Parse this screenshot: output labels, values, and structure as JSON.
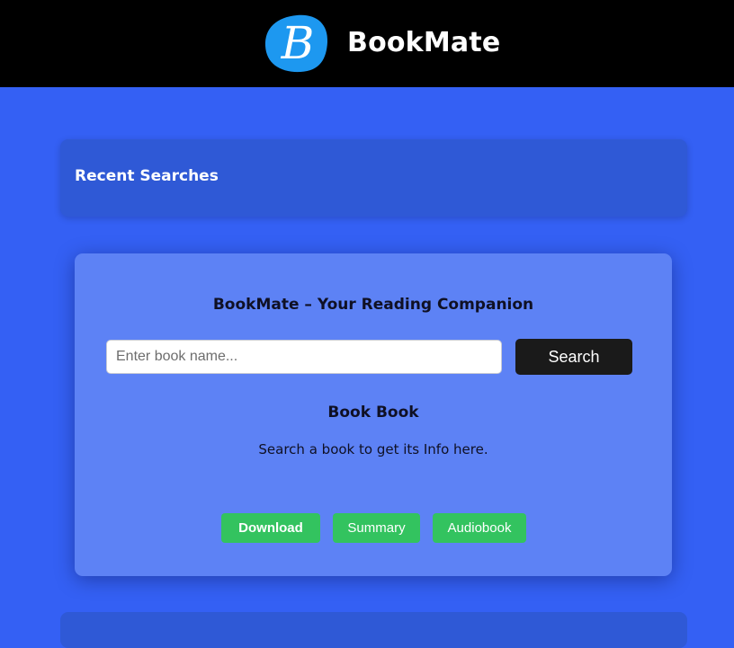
{
  "header": {
    "logo_letter": "B",
    "brand": "BookMate"
  },
  "recent": {
    "title": "Recent Searches"
  },
  "main": {
    "title": "BookMate – Your Reading Companion",
    "search": {
      "placeholder": "Enter book name...",
      "value": "",
      "button_label": "Search"
    },
    "book_title": "Book Book",
    "book_description": "Search a book to get its Info here.",
    "actions": {
      "download_label": "Download",
      "summary_label": "Summary",
      "audiobook_label": "Audiobook"
    }
  },
  "colors": {
    "page_background": "#3460f4",
    "header_background": "#000000",
    "logo_blue": "#1d98f0",
    "panel_background": "#2f59d6",
    "card_background": "#5d82f5",
    "search_button": "#1a1a1a",
    "action_green": "#33c35f"
  }
}
